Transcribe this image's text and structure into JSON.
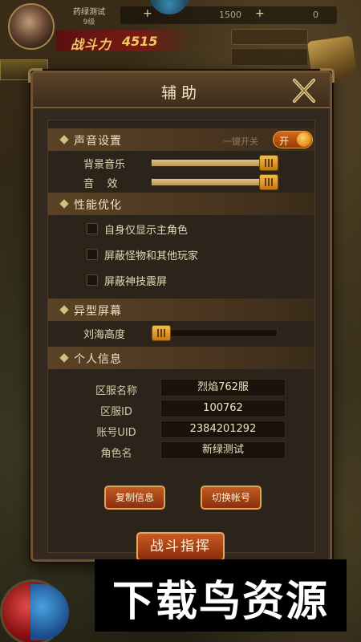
{
  "hud": {
    "player_name": "药绿测试",
    "player_level": "9级",
    "power_label": "战斗力",
    "power_value": "4515",
    "gold": "1500",
    "diamond": "0",
    "plus": "+"
  },
  "modal": {
    "title": "辅助",
    "sections": {
      "sound": {
        "title": "声音设置",
        "toggle_label": "一键开关",
        "toggle_text": "开",
        "toggle_on": true,
        "bgm_label": "背景音乐",
        "sfx_label": "音    效",
        "bgm_level": 1.0,
        "sfx_level": 1.0
      },
      "performance": {
        "title": "性能优化",
        "options": [
          {
            "label": "自身仅显示主角色",
            "checked": false
          },
          {
            "label": "屏蔽怪物和其他玩家",
            "checked": false
          },
          {
            "label": "屏蔽神技震屏",
            "checked": false
          }
        ]
      },
      "screen": {
        "title": "异型屏幕",
        "notch_label": "刘海高度",
        "notch_level": 0.0
      },
      "info": {
        "title": "个人信息",
        "rows": [
          {
            "label": "区服名称",
            "value": "烈焰762服"
          },
          {
            "label": "区服ID",
            "value": "100762"
          },
          {
            "label": "账号UID",
            "value": "2384201292"
          },
          {
            "label": "角色名",
            "value": "新绿测试"
          }
        ]
      }
    },
    "copy_button": "复制信息",
    "switch_button": "切换帐号"
  },
  "battle_button": "战斗指挥",
  "watermark": "下载鸟资源",
  "colors": {
    "accent_orange": "#c25a22",
    "gold_text": "#f0c860",
    "panel_bg": "#2c241b"
  }
}
